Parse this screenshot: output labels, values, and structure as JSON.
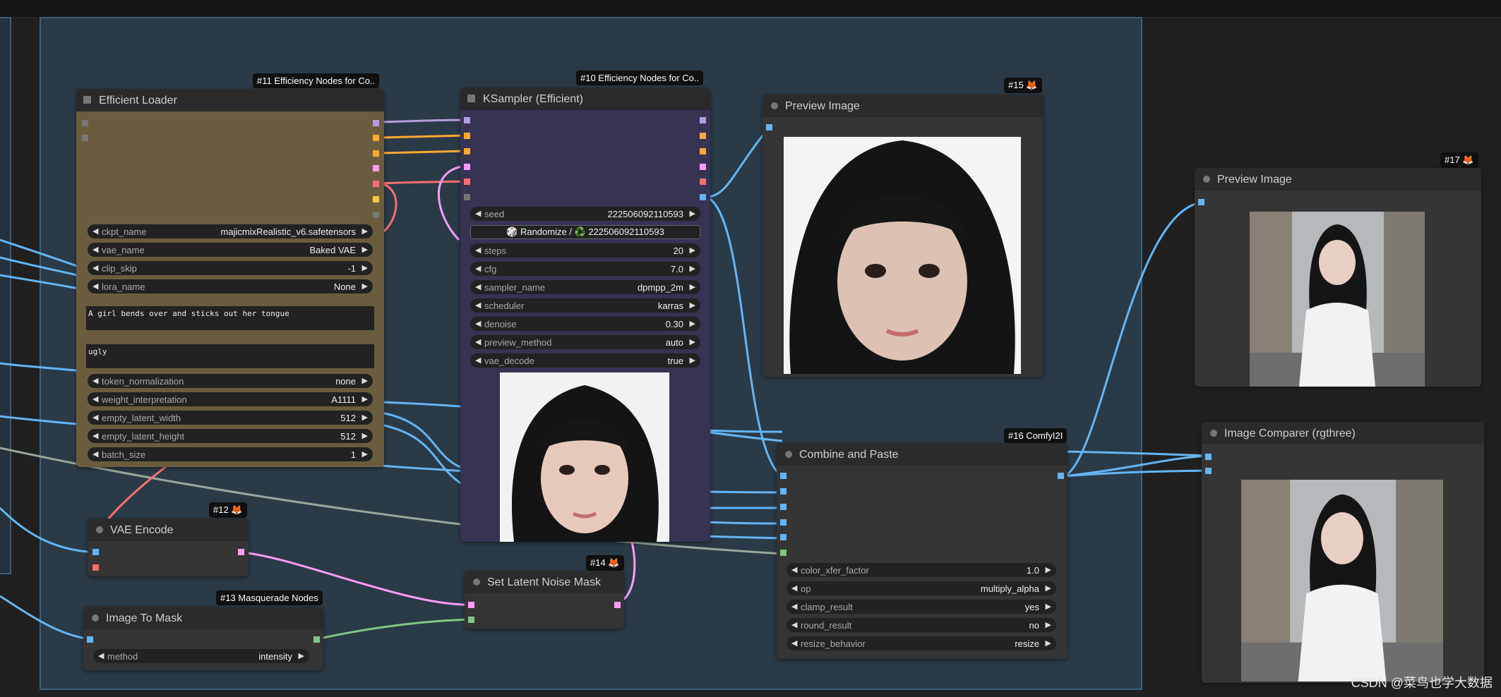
{
  "efficient_loader": {
    "badge": "#11 Efficiency Nodes for Co..",
    "title": "Efficient Loader",
    "widgets": [
      {
        "name": "ckpt_name",
        "value": "majicmixRealistic_v6.safetensors"
      },
      {
        "name": "vae_name",
        "value": "Baked VAE"
      },
      {
        "name": "clip_skip",
        "value": "-1"
      },
      {
        "name": "lora_name",
        "value": "None"
      }
    ],
    "positive_prompt": "A girl bends over and sticks out her tongue",
    "negative_prompt": "ugly",
    "widgets2": [
      {
        "name": "token_normalization",
        "value": "none"
      },
      {
        "name": "weight_interpretation",
        "value": "A1111"
      },
      {
        "name": "empty_latent_width",
        "value": "512"
      },
      {
        "name": "empty_latent_height",
        "value": "512"
      },
      {
        "name": "batch_size",
        "value": "1"
      }
    ]
  },
  "ksampler": {
    "badge": "#10 Efficiency Nodes for Co..",
    "title": "KSampler (Efficient)",
    "seed": {
      "name": "seed",
      "value": "222506092110593"
    },
    "randomize_button": "🎲 Randomize / ♻️ 222506092110593",
    "widgets": [
      {
        "name": "steps",
        "value": "20"
      },
      {
        "name": "cfg",
        "value": "7.0"
      },
      {
        "name": "sampler_name",
        "value": "dpmpp_2m"
      },
      {
        "name": "scheduler",
        "value": "karras"
      },
      {
        "name": "denoise",
        "value": "0.30"
      },
      {
        "name": "preview_method",
        "value": "auto"
      },
      {
        "name": "vae_decode",
        "value": "true"
      }
    ]
  },
  "preview15": {
    "badge": "#15 🦊",
    "title": "Preview Image"
  },
  "preview17": {
    "badge": "#17 🦊",
    "title": "Preview Image"
  },
  "combine": {
    "badge": "#16 ComfyI2I",
    "title": "Combine and Paste",
    "widgets": [
      {
        "name": "color_xfer_factor",
        "value": "1.0"
      },
      {
        "name": "op",
        "value": "multiply_alpha"
      },
      {
        "name": "clamp_result",
        "value": "yes"
      },
      {
        "name": "round_result",
        "value": "no"
      },
      {
        "name": "resize_behavior",
        "value": "resize"
      }
    ]
  },
  "comparer": {
    "title": "Image Comparer (rgthree)"
  },
  "vae_encode": {
    "badge": "#12 🦊",
    "title": "VAE Encode"
  },
  "image_to_mask": {
    "badge": "#13 Masquerade Nodes",
    "title": "Image To Mask",
    "method": {
      "name": "method",
      "value": "intensity"
    }
  },
  "latent_mask": {
    "badge": "#14 🦊",
    "title": "Set Latent Noise Mask"
  },
  "watermark": "CSDN @菜鸟也学大数据",
  "colors": {
    "model": "#b39ddb",
    "clip": "#f5c842",
    "conditioning": "#ffa931",
    "latent": "#ff9cf9",
    "vae": "#ff6e6e",
    "image": "#64b5f6",
    "mask": "#81c784"
  }
}
